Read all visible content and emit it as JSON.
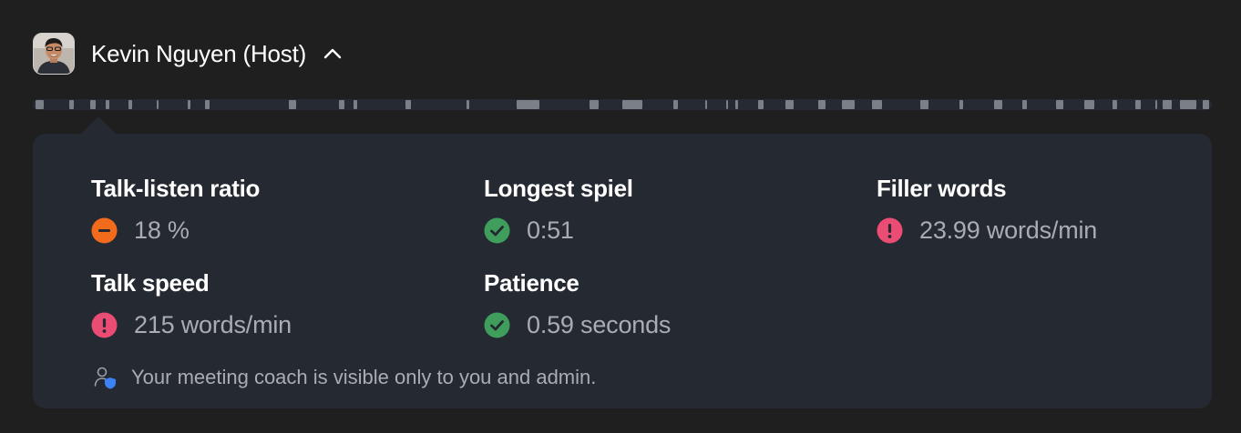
{
  "host": {
    "name": "Kevin Nguyen (Host)",
    "avatar_icon": "person-avatar",
    "toggle_icon": "chevron-up-icon"
  },
  "timeline": {
    "segments": [
      [
        0.2,
        0.9
      ],
      [
        3.1,
        3.5
      ],
      [
        4.9,
        5.3
      ],
      [
        6.2,
        6.5
      ],
      [
        8.1,
        8.4
      ],
      [
        10.5,
        10.7
      ],
      [
        13.1,
        13.4
      ],
      [
        14.6,
        15.0
      ],
      [
        21.7,
        22.3
      ],
      [
        26.0,
        26.4
      ],
      [
        27.2,
        27.5
      ],
      [
        31.6,
        32.1
      ],
      [
        36.8,
        37.0
      ],
      [
        41.0,
        43.0
      ],
      [
        47.2,
        48.0
      ],
      [
        50.0,
        51.7
      ],
      [
        54.3,
        54.7
      ],
      [
        57.0,
        57.1
      ],
      [
        58.8,
        59.0
      ],
      [
        59.6,
        59.8
      ],
      [
        61.5,
        62.0
      ],
      [
        63.8,
        64.5
      ],
      [
        66.6,
        67.2
      ],
      [
        68.6,
        69.7
      ],
      [
        71.2,
        72.0
      ],
      [
        75.3,
        76.0
      ],
      [
        78.6,
        78.9
      ],
      [
        81.5,
        82.2
      ],
      [
        83.9,
        84.3
      ],
      [
        86.8,
        87.4
      ],
      [
        89.2,
        90.0
      ],
      [
        91.6,
        92.0
      ],
      [
        93.5,
        94.0
      ],
      [
        95.2,
        95.3
      ],
      [
        95.8,
        96.6
      ],
      [
        97.3,
        98.7
      ],
      [
        99.2,
        99.8
      ]
    ],
    "segment_color": "#7b8086",
    "track_color": "#262b33"
  },
  "metrics": {
    "talk_listen": {
      "title": "Talk-listen ratio",
      "value": "18 %",
      "status": "neutral",
      "icon": "minus-circle-icon",
      "color": "#f26b1d"
    },
    "longest_spiel": {
      "title": "Longest spiel",
      "value": "0:51",
      "status": "good",
      "icon": "check-circle-icon",
      "color": "#3f9e5b"
    },
    "filler_words": {
      "title": "Filler words",
      "value": "23.99 words/min",
      "status": "warning",
      "icon": "exclamation-circle-icon",
      "color": "#ea4c74"
    },
    "talk_speed": {
      "title": "Talk speed",
      "value": "215 words/min",
      "status": "warning",
      "icon": "exclamation-circle-icon",
      "color": "#ea4c74"
    },
    "patience": {
      "title": "Patience",
      "value": "0.59 seconds",
      "status": "good",
      "icon": "check-circle-icon",
      "color": "#3f9e5b"
    }
  },
  "footer": {
    "note": "Your meeting coach is visible only to you and admin.",
    "icon": "user-shield-icon"
  },
  "colors": {
    "background": "#1f1f20",
    "panel": "#252932",
    "text_primary": "#ffffff",
    "text_secondary": "#a9adb3"
  }
}
